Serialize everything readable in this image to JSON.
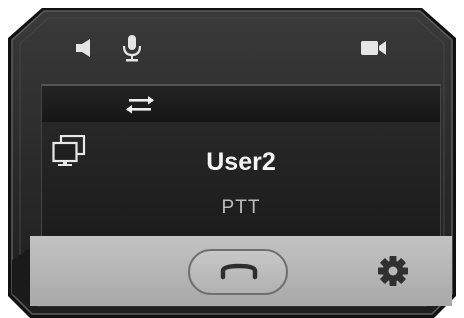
{
  "toolbar": {
    "speaker_icon": "speaker-icon",
    "microphone_icon": "microphone-icon",
    "video_icon": "video-camera-icon"
  },
  "screen": {
    "swap_icon": "swap-arrows-icon",
    "monitor_icon": "monitor-icon",
    "user_name": "User2",
    "call_status": "PTT"
  },
  "bottom_bar": {
    "hangup_icon": "hang-up-icon",
    "settings_icon": "gear-icon"
  },
  "colors": {
    "frame": "#2a2a2a",
    "screen": "#222222",
    "bottom_bar": "#b5b5b5",
    "icon_light": "#e6e6e6",
    "icon_dark": "#333333"
  }
}
